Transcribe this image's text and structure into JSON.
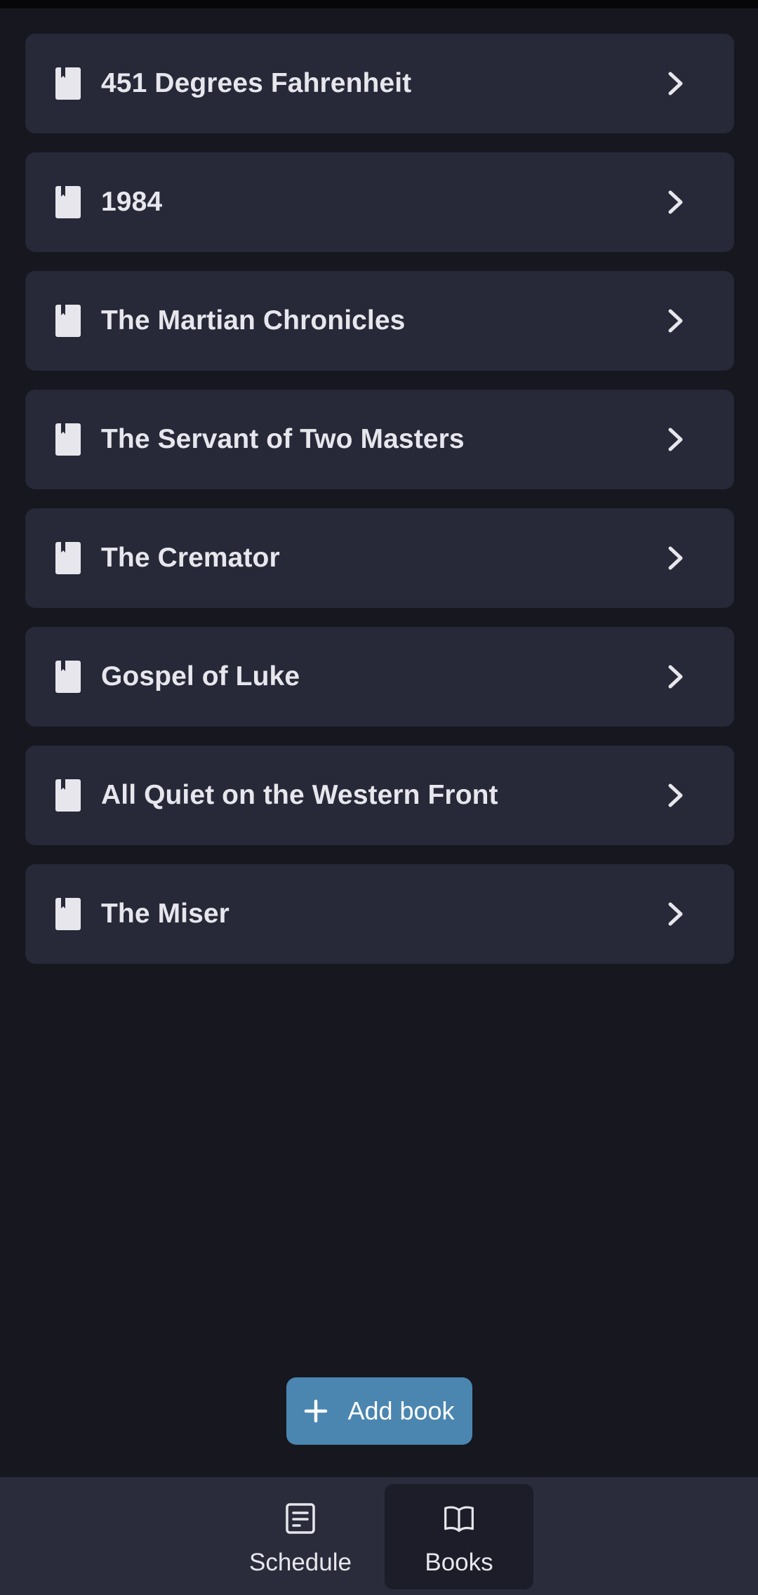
{
  "books": [
    {
      "title": "451 Degrees Fahrenheit"
    },
    {
      "title": "1984"
    },
    {
      "title": "The Martian Chronicles"
    },
    {
      "title": "The Servant of Two Masters"
    },
    {
      "title": "The Cremator"
    },
    {
      "title": "Gospel of Luke"
    },
    {
      "title": "All Quiet on the Western Front"
    },
    {
      "title": "The Miser"
    }
  ],
  "icons": {
    "book_item": "bookmark-book-icon",
    "chevron": "chevron-right-icon",
    "add": "plus-icon",
    "schedule": "schedule-note-icon",
    "books": "open-book-icon"
  },
  "add_button": {
    "label": "Add book"
  },
  "nav": {
    "items": [
      {
        "label": "Schedule",
        "active": false
      },
      {
        "label": "Books",
        "active": true
      }
    ]
  },
  "colors": {
    "background": "#16171f",
    "card": "#272838",
    "accent": "#4a86b0",
    "nav_bar": "#2a2c3c",
    "nav_active": "#1c1d28",
    "text": "#e6e6ec"
  }
}
